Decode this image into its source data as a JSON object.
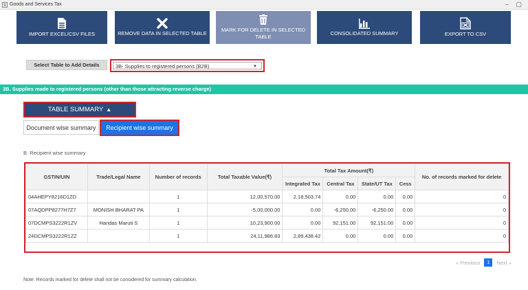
{
  "window": {
    "title": "Goods and Services Tax",
    "minimize_glyph": "–",
    "maximize_glyph": "▢"
  },
  "toolbar": {
    "buttons": [
      {
        "label": "IMPORT EXCEL/CSV FILES",
        "icon": "file-import-icon"
      },
      {
        "label": "REMOVE DATA IN SELECTED TABLE",
        "icon": "close-icon"
      },
      {
        "label": "MARK FOR DELETE IN SELECTED TABLE",
        "icon": "trash-icon",
        "disabled": true
      },
      {
        "label": "CONSOLIDATED SUMMARY",
        "icon": "bar-chart-icon"
      },
      {
        "label": "EXPORT TO CSV",
        "icon": "export-csv-icon"
      }
    ]
  },
  "select_table": {
    "label": "Select Table to Add Details",
    "value": "3B- Supplies to registered persons (B2B)"
  },
  "section": {
    "header": "3B. Supplies made to registered persons (other than those attracting reverse charge)"
  },
  "summary": {
    "toggle_label": "TABLE SUMMARY",
    "tabs": {
      "document": "Document wise summary",
      "recipient": "Recipient wise summary"
    },
    "subheading": "B. Recipient wise summary"
  },
  "table": {
    "headers": {
      "gstin": "GSTIN/UIN",
      "trade": "Trade/Legal Name",
      "records": "Number of records",
      "taxable": "Total Taxable Value(₹)",
      "tax_group": "Total Tax Amount(₹)",
      "igst": "Integrated Tax",
      "cgst": "Central Tax",
      "sgst": "State/UT Tax",
      "cess": "Cess",
      "marked": "No. of records marked for delete"
    },
    "rows": [
      {
        "gstin": "04AHEPY8216D1ZD",
        "trade": "",
        "records": "1",
        "taxable": "12,00,570.00",
        "igst": "2,18,503.74",
        "cgst": "0.00",
        "sgst": "0.00",
        "cess": "0.00",
        "marked": "0"
      },
      {
        "gstin": "07AQDPP8277H7Z7",
        "trade": "MONISH BHARAT PA",
        "records": "1",
        "taxable": "-5,00,000.00",
        "igst": "0.00",
        "cgst": "-6,250.00",
        "sgst": "-6,250.00",
        "cess": "0.00",
        "marked": "0"
      },
      {
        "gstin": "07DCMPS3222R1ZV",
        "trade": "Haridas Maruti S",
        "records": "1",
        "taxable": "10,23,900.00",
        "igst": "0.00",
        "cgst": "92,151.00",
        "sgst": "92,151.00",
        "cess": "0.00",
        "marked": "0"
      },
      {
        "gstin": "24DCMPS3222R1ZZ",
        "trade": "",
        "records": "1",
        "taxable": "24,11,986.83",
        "igst": "2,89,438.42",
        "cgst": "0.00",
        "sgst": "0.00",
        "cess": "0.00",
        "marked": "0"
      }
    ]
  },
  "pagination": {
    "prev": "« Previous",
    "current": "1",
    "next": "Next »"
  },
  "note": "Note: Records marked for delete shall not be considered for summary calculation.",
  "colors": {
    "toolbar": "#2c4a7a",
    "toolbar_disabled": "#7f8eb3",
    "section": "#21c4a4",
    "highlight": "#d0232b",
    "active_tab": "#1a73e8"
  }
}
